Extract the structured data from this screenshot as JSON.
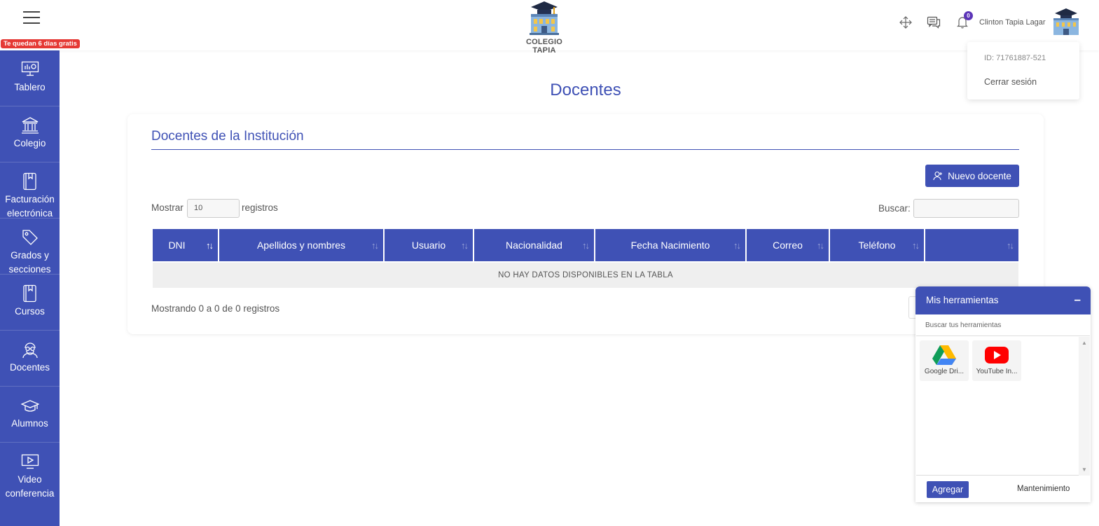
{
  "header": {
    "trial_badge": "Te quedan 6 días gratis",
    "logo_text": "COLEGIO TAPIA",
    "notification_count": "0",
    "user_name": "Clinton Tapia Lagar"
  },
  "profile_menu": {
    "id_text": "ID: 71761887-521",
    "logout": "Cerrar sesión"
  },
  "sidebar": {
    "items": [
      {
        "label": "Tablero",
        "icon": "presentation-board-icon"
      },
      {
        "label": "Colegio",
        "icon": "institution-icon"
      },
      {
        "label": "Facturación electrónica",
        "icon": "book-icon"
      },
      {
        "label": "Grados y secciones",
        "icon": "tag-icon"
      },
      {
        "label": "Cursos",
        "icon": "book-icon"
      },
      {
        "label": "Docentes",
        "icon": "teacher-icon"
      },
      {
        "label": "Alumnos",
        "icon": "graduation-cap-icon"
      },
      {
        "label": "Video conferencia",
        "icon": "video-screen-icon"
      }
    ]
  },
  "page": {
    "title": "Docentes",
    "card_title": "Docentes de la Institución",
    "new_button": "Nuevo docente",
    "show_label": "Mostrar",
    "show_value": "10",
    "records_label": "registros",
    "search_label": "Buscar:",
    "search_value": "",
    "columns": [
      "DNI",
      "Apellidos y nombres",
      "Usuario",
      "Nacionalidad",
      "Fecha Nacimiento",
      "Correo",
      "Teléfono",
      ""
    ],
    "empty_message": "NO HAY DATOS DISPONIBLES EN LA TABLA",
    "info": "Mostrando 0 a 0 de 0 registros"
  },
  "tools": {
    "title": "Mis herramientas",
    "minimize": "–",
    "search_placeholder": "Buscar tus herramientas",
    "items": [
      {
        "name": "Google Dri...",
        "icon": "google-drive-icon"
      },
      {
        "name": "YouTube In...",
        "icon": "youtube-icon"
      }
    ],
    "add_button": "Agregar",
    "maintenance": "Mantenimiento"
  },
  "colors": {
    "primary": "#3f51b5",
    "badge_red": "#e53935",
    "notif_purple": "#5c35b8"
  }
}
